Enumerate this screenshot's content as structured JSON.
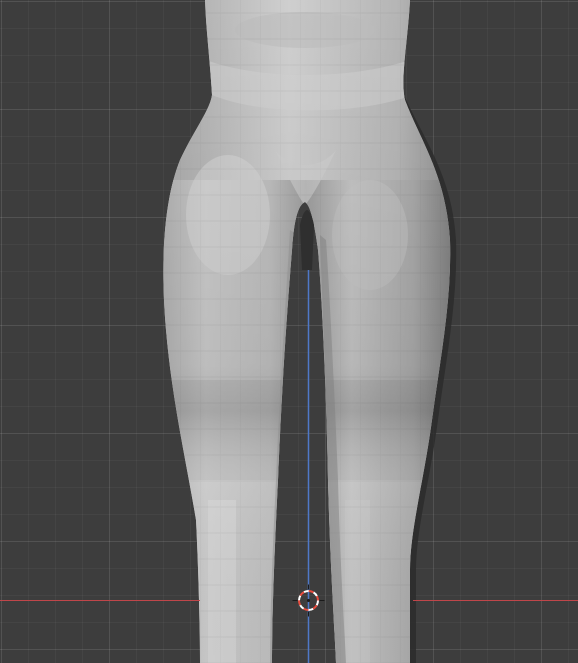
{
  "viewport": {
    "view": "front-orthographic",
    "background_color": "#3d3d3d",
    "grid": true,
    "grid_color": "#4b4b4b",
    "x_axis_color": "#c0464a",
    "z_axis_color": "#4f78c8"
  },
  "mesh": {
    "object": "female-lower-body",
    "shading": "solid",
    "base_color": "#c2c2c2",
    "selected": false
  },
  "cursor_3d": {
    "icon": "3d-cursor-icon",
    "ring_colors": [
      "#e84a3c",
      "#ffffff"
    ]
  }
}
